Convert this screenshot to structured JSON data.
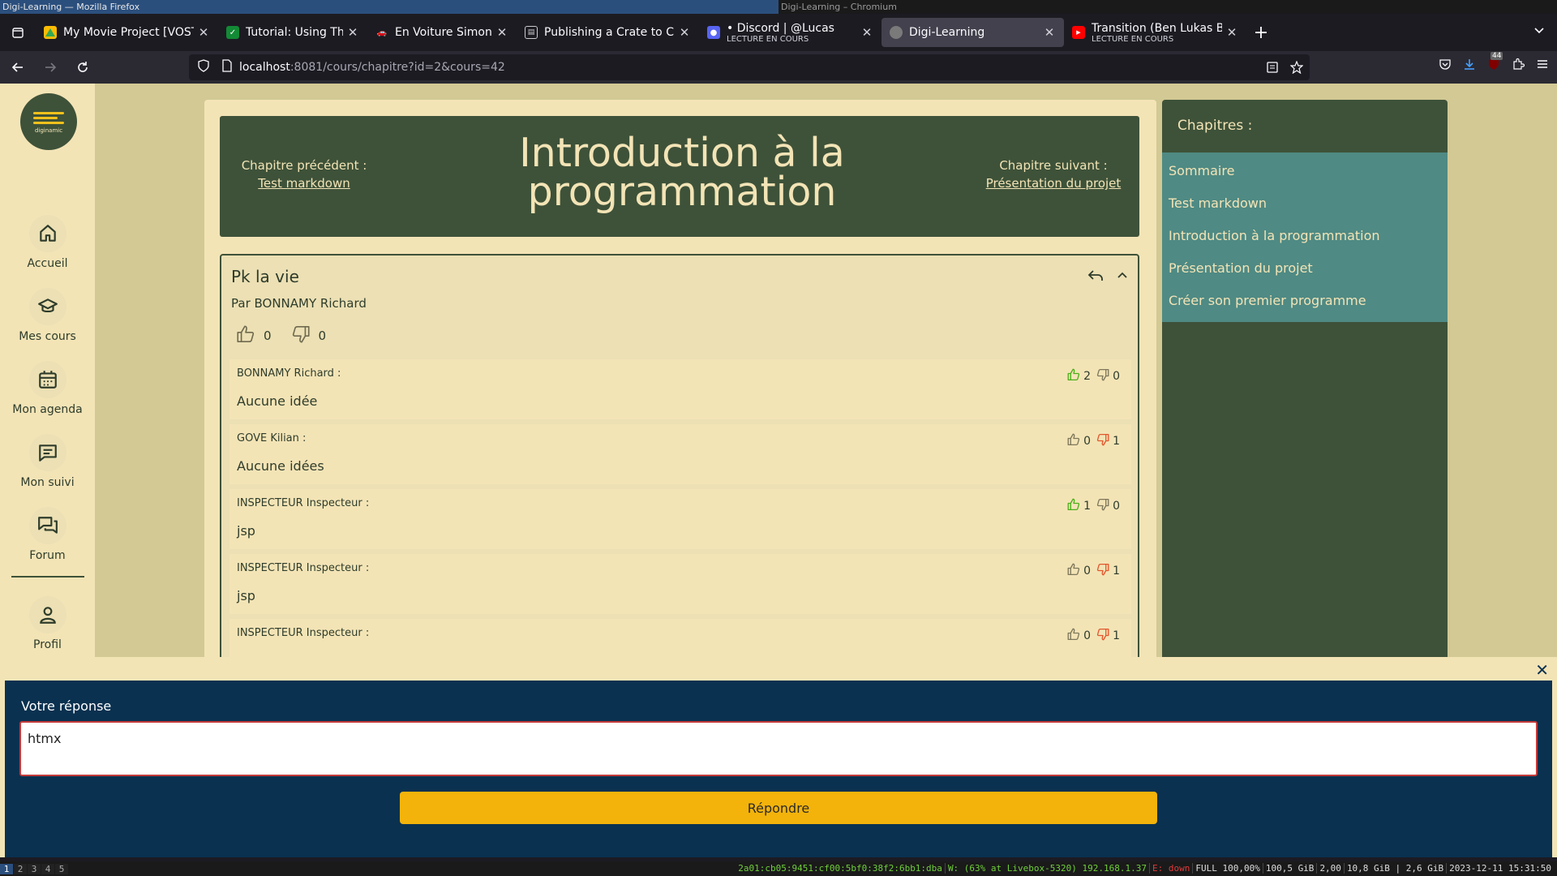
{
  "window": {
    "left_title": "Digi-Learning — Mozilla Firefox",
    "right_title": "Digi-Learning – Chromium"
  },
  "tabs": [
    {
      "title": "My Movie Project [VOSTF",
      "sub": "",
      "icon": "drive-icon",
      "color": "#4285f4"
    },
    {
      "title": "Tutorial: Using Thymeleaf",
      "sub": "",
      "icon": "thymeleaf-icon",
      "color": "#138a35"
    },
    {
      "title": "En Voiture Simone",
      "sub": "",
      "icon": "car-icon",
      "color": "#555"
    },
    {
      "title": "Publishing a Crate to Cra",
      "sub": "",
      "icon": "book-icon",
      "color": "#777"
    },
    {
      "title": "• Discord | @Lucas",
      "sub": "LECTURE EN COURS",
      "icon": "discord-icon",
      "color": "#5865f2"
    },
    {
      "title": "Digi-Learning",
      "sub": "",
      "icon": "digi-icon",
      "color": "#3e5239"
    },
    {
      "title": "Transition (Ben Lukas Bo",
      "sub": "LECTURE EN COURS",
      "icon": "youtube-icon",
      "color": "#ff0000"
    }
  ],
  "nav": {
    "url_host": "localhost",
    "url_rest": ":8081/cours/chapitre?id=2&cours=42",
    "badge": "44"
  },
  "sidebar": {
    "logo_text": "diginamic",
    "items": [
      {
        "label": "Accueil",
        "icon": "home-icon"
      },
      {
        "label": "Mes cours",
        "icon": "graduation-cap-icon"
      },
      {
        "label": "Mon agenda",
        "icon": "calendar-icon"
      },
      {
        "label": "Mon suivi",
        "icon": "message-icon"
      },
      {
        "label": "Forum",
        "icon": "forum-icon"
      },
      {
        "label": "Profil",
        "icon": "user-icon"
      }
    ]
  },
  "chapter": {
    "prev_label": "Chapitre précédent :",
    "prev_link": "Test markdown",
    "title": "Introduction à la programmation",
    "next_label": "Chapitre suivant :",
    "next_link": "Présentation du projet"
  },
  "question": {
    "title": "Pk la vie",
    "author": "Par BONNAMY Richard",
    "likes": "0",
    "dislikes": "0"
  },
  "answers": [
    {
      "author": "BONNAMY Richard :",
      "text": "Aucune idée",
      "likes": "2",
      "dislikes": "0",
      "liked": true,
      "disliked": false
    },
    {
      "author": "GOVE Kilian :",
      "text": "Aucune idées",
      "likes": "0",
      "dislikes": "1",
      "liked": false,
      "disliked": true
    },
    {
      "author": "INSPECTEUR Inspecteur :",
      "text": "jsp",
      "likes": "1",
      "dislikes": "0",
      "liked": true,
      "disliked": false
    },
    {
      "author": "INSPECTEUR Inspecteur :",
      "text": "jsp",
      "likes": "0",
      "dislikes": "1",
      "liked": false,
      "disliked": true
    },
    {
      "author": "INSPECTEUR Inspecteur :",
      "text": "",
      "likes": "0",
      "dislikes": "1",
      "liked": false,
      "disliked": true
    }
  ],
  "chapters": {
    "heading": "Chapitres :",
    "items": [
      "Sommaire",
      "Test markdown",
      "Introduction à la programmation",
      "Présentation du projet",
      "Créer son premier programme"
    ]
  },
  "reply": {
    "label": "Votre réponse",
    "value": "htmx",
    "button": "Répondre"
  },
  "statusbar": {
    "workspaces": [
      "1",
      "2",
      "3",
      "4",
      "5"
    ],
    "ipv6": "2a01:cb05:9451:cf00:5bf0:38f2:6bb1:dba",
    "wifi": "W: (63% at Livebox-5320) 192.168.1.37",
    "eth": "E: down",
    "battery": "FULL 100,00%",
    "disk": "100,5 GiB",
    "load": "2,00",
    "mem": "10,8 GiB | 2,6 GiB",
    "datetime": "2023-12-11 15:31:50"
  },
  "colors": {
    "accent_green": "#3e5239",
    "teal": "#4f8a84",
    "cream": "#f3e4b6",
    "button_yellow": "#f3b30b",
    "reply_bg": "#0a3150",
    "like_green": "#4caf1a",
    "dislike_orange": "#e2572e"
  }
}
